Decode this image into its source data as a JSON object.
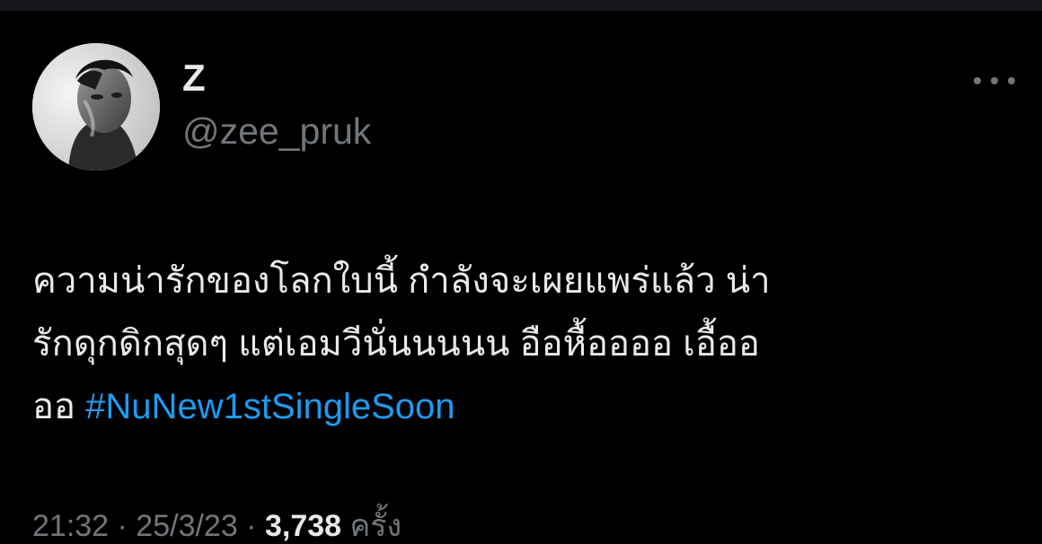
{
  "tweet": {
    "author": {
      "display_name": "Z",
      "handle": "@zee_pruk",
      "avatar_icon": "profile-photo-grayscale"
    },
    "more_icon": "ellipsis-horizontal-icon",
    "text_lines": [
      "ความน่ารักของโลกใบนี้ กำลังจะเผยแพร่แล้ว น่า",
      "รักดุกดิกสุดๆ แต่เอมวีนั่นนนนน อือหื้ออออ เอื้ออ",
      "ออ "
    ],
    "hashtag": "#NuNew1stSingleSoon",
    "meta": {
      "time": "21:32 · 25/3/23 ·",
      "views_count": "3,738",
      "views_label": "ครั้ง"
    }
  },
  "colors": {
    "background": "#000000",
    "text": "#e7e9ea",
    "secondary": "#71767b",
    "link": "#1d9bf0"
  }
}
